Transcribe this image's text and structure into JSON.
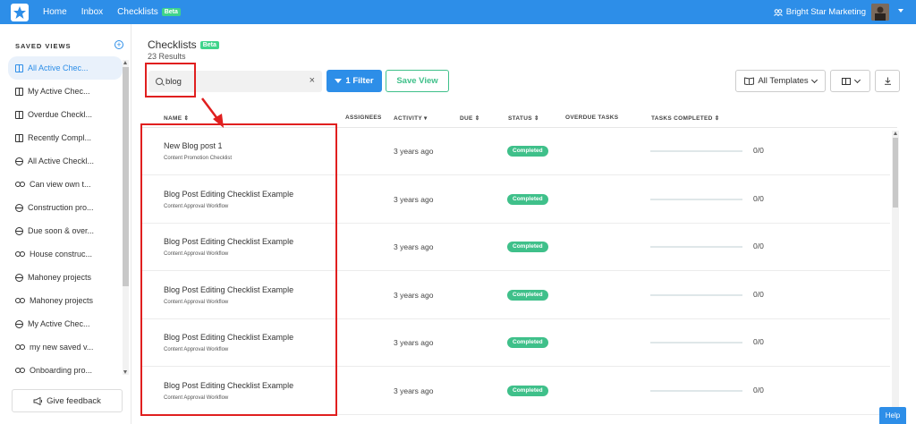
{
  "topbar": {
    "nav": [
      "Home",
      "Inbox",
      "Checklists"
    ],
    "beta_label": "Beta",
    "org_name": "Bright Star Marketing"
  },
  "sidebar": {
    "title": "SAVED VIEWS",
    "items": [
      {
        "label": "All Active Chec...",
        "icon": "book-icon",
        "active": true
      },
      {
        "label": "My Active Chec...",
        "icon": "book-icon"
      },
      {
        "label": "Overdue Checkl...",
        "icon": "book-icon"
      },
      {
        "label": "Recently Compl...",
        "icon": "book-icon"
      },
      {
        "label": "All Active Checkl...",
        "icon": "globe-icon"
      },
      {
        "label": "Can view own t...",
        "icon": "users-icon"
      },
      {
        "label": "Construction pro...",
        "icon": "globe-icon"
      },
      {
        "label": "Due soon & over...",
        "icon": "globe-icon"
      },
      {
        "label": "House construc...",
        "icon": "users-icon"
      },
      {
        "label": "Mahoney projects",
        "icon": "globe-icon"
      },
      {
        "label": "Mahoney projects",
        "icon": "users-icon"
      },
      {
        "label": "My Active Chec...",
        "icon": "globe-icon"
      },
      {
        "label": "my new saved v...",
        "icon": "users-icon"
      },
      {
        "label": "Onboarding pro...",
        "icon": "users-icon"
      }
    ],
    "feedback_label": "Give feedback"
  },
  "main": {
    "title": "Checklists",
    "results": "23 Results",
    "search": {
      "value": "blog"
    },
    "filter_label": "1 Filter",
    "save_view_label": "Save View",
    "templates_label": "All Templates"
  },
  "table": {
    "headers": {
      "name": "NAME",
      "assignees": "ASSIGNEES",
      "activity": "ACTIVITY",
      "due": "DUE",
      "status": "STATUS",
      "overdue": "OVERDUE TASKS",
      "completed": "TASKS COMPLETED"
    },
    "rows": [
      {
        "name": "New Blog post 1",
        "template": "Content Promotion Checklist",
        "activity": "3 years ago",
        "status": "Completed",
        "tasks": "0/0",
        "progress": 0
      },
      {
        "name": "Blog Post Editing Checklist Example",
        "template": "Content Approval Workflow",
        "activity": "3 years ago",
        "status": "Completed",
        "tasks": "0/0",
        "progress": 0
      },
      {
        "name": "Blog Post Editing Checklist Example",
        "template": "Content Approval Workflow",
        "activity": "3 years ago",
        "status": "Completed",
        "tasks": "0/0",
        "progress": 0
      },
      {
        "name": "Blog Post Editing Checklist Example",
        "template": "Content Approval Workflow",
        "activity": "3 years ago",
        "status": "Completed",
        "tasks": "0/0",
        "progress": 0
      },
      {
        "name": "Blog Post Editing Checklist Example",
        "template": "Content Approval Workflow",
        "activity": "3 years ago",
        "status": "Completed",
        "tasks": "0/0",
        "progress": 0
      },
      {
        "name": "Blog Post Editing Checklist Example",
        "template": "Content Approval Workflow",
        "activity": "3 years ago",
        "status": "Completed",
        "tasks": "0/0",
        "progress": 0
      }
    ]
  },
  "help_label": "Help",
  "colors": {
    "primary": "#2d8ee8",
    "success": "#3fc08a",
    "annotation": "#e01f1f"
  }
}
